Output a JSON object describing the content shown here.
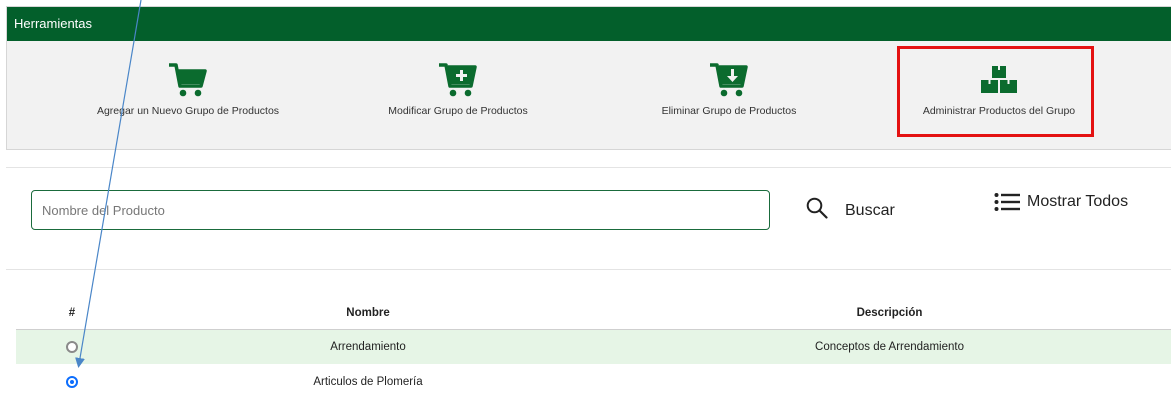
{
  "toolbar": {
    "title": "Herramientas",
    "items": [
      {
        "label": "Agregar un Nuevo Grupo de Productos",
        "icon": "cart-icon"
      },
      {
        "label": "Modificar Grupo de Productos",
        "icon": "cart-plus-icon"
      },
      {
        "label": "Eliminar Grupo de Productos",
        "icon": "cart-download-icon"
      },
      {
        "label": "Administrar Productos del Grupo",
        "icon": "boxes-icon"
      }
    ]
  },
  "search": {
    "placeholder": "Nombre del Producto",
    "search_label": "Buscar",
    "show_all_label": "Mostrar Todos"
  },
  "table": {
    "headers": [
      "#",
      "Nombre",
      "Descripción"
    ],
    "rows": [
      {
        "name": "Arrendamiento",
        "description": "Conceptos de Arrendamiento",
        "selected": false
      },
      {
        "name": "Articulos de Plomería",
        "description": "",
        "selected": true
      }
    ]
  },
  "colors": {
    "header": "#035f2b",
    "icon": "#0b6b2e",
    "highlight": "#e41212",
    "selected_row": "#e6f5e6",
    "radio_selected": "#0d6efd"
  }
}
